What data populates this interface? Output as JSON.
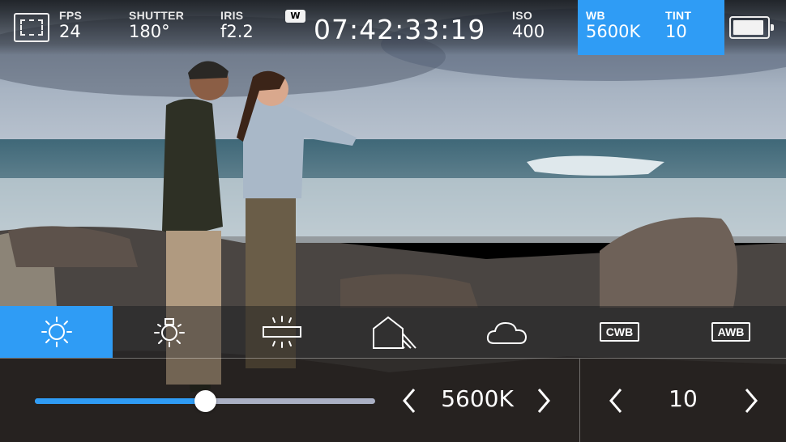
{
  "top": {
    "fps": {
      "label": "FPS",
      "value": "24"
    },
    "shutter": {
      "label": "SHUTTER",
      "value": "180°"
    },
    "iris": {
      "label": "IRIS",
      "value": "f2.2"
    },
    "w_badge": "W",
    "timecode": "07:42:33:19",
    "iso": {
      "label": "ISO",
      "value": "400"
    },
    "wb": {
      "label": "WB",
      "value": "5600K"
    },
    "tint": {
      "label": "TINT",
      "value": "10"
    },
    "battery_level": 0.85
  },
  "presets": [
    {
      "name": "sun-icon",
      "active": true
    },
    {
      "name": "tungsten-bulb-icon",
      "active": false
    },
    {
      "name": "fluorescent-icon",
      "active": false
    },
    {
      "name": "shade-icon",
      "active": false
    },
    {
      "name": "cloud-icon",
      "active": false
    },
    {
      "name": "cwb-icon",
      "label": "CWB",
      "active": false
    },
    {
      "name": "awb-icon",
      "label": "AWB",
      "active": false
    }
  ],
  "wb_control": {
    "value": "5600K",
    "slider_position": 0.5
  },
  "tint_control": {
    "value": "10"
  },
  "colors": {
    "accent": "#2f9cf5",
    "track": "#aab0c4"
  }
}
